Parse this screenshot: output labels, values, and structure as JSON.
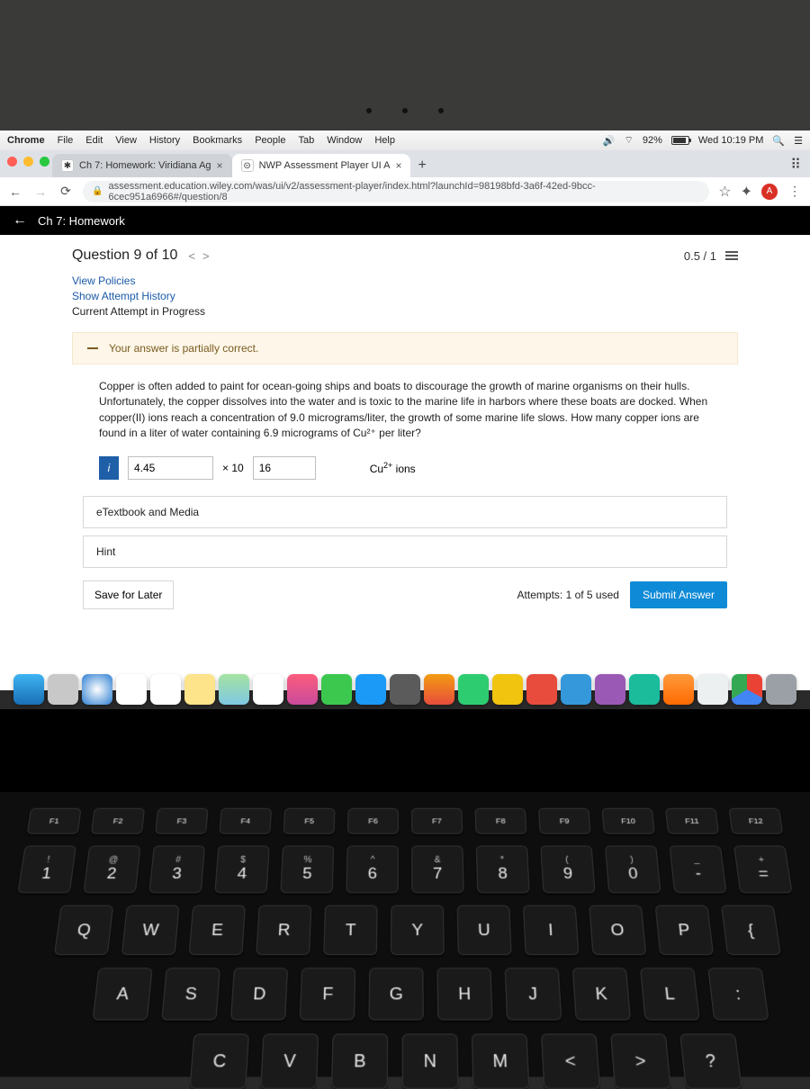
{
  "mac": {
    "app": "Chrome",
    "menus": [
      "File",
      "Edit",
      "View",
      "History",
      "Bookmarks",
      "People",
      "Tab",
      "Window",
      "Help"
    ],
    "battery_pct": "92%",
    "clock": "Wed 10:19 PM"
  },
  "browser": {
    "tabs": [
      {
        "title": "Ch 7: Homework: Viridiana Ag"
      },
      {
        "title": "NWP Assessment Player UI A"
      }
    ],
    "url": "assessment.education.wiley.com/was/ui/v2/assessment-player/index.html?launchId=98198bfd-3a6f-42ed-9bcc-6cec951a6966#/question/8"
  },
  "assessment": {
    "breadcrumb": "Ch 7: Homework",
    "question_label": "Question 9 of 10",
    "score": "0.5 / 1",
    "link_policies": "View Policies",
    "link_history": "Show Attempt History",
    "current_attempt": "Current Attempt in Progress",
    "banner": "Your answer is partially correct.",
    "prompt": "Copper is often added to paint for ocean-going ships and boats to discourage the growth of marine organisms on their hulls. Unfortunately, the copper dissolves into the water and is toxic to the marine life in harbors where these boats are docked. When copper(II) ions reach a concentration of 9.0 micrograms/liter, the growth of some marine life slows. How many copper ions are found in a liter of water containing 6.9 micrograms of Cu²⁺ per liter?",
    "info_label": "i",
    "value1": "4.45",
    "times_label": "× 10",
    "value2": "16",
    "unit_html": "Cu²⁺ ions",
    "panel_etext": "eTextbook and Media",
    "panel_hint": "Hint",
    "save_label": "Save for Later",
    "attempts": "Attempts: 1 of 5 used",
    "submit_label": "Submit Answer"
  },
  "keyboard": {
    "fn": [
      "F1",
      "F2",
      "F3",
      "F4",
      "F5",
      "F6",
      "F7",
      "F8",
      "F9",
      "F10",
      "F11",
      "F12"
    ],
    "num_top": [
      "!",
      "@",
      "#",
      "$",
      "%",
      "^",
      "&",
      "*",
      "(",
      ")",
      "_",
      "+"
    ],
    "num": [
      "1",
      "2",
      "3",
      "4",
      "5",
      "6",
      "7",
      "8",
      "9",
      "0",
      "-",
      "="
    ],
    "r1": [
      "Q",
      "W",
      "E",
      "R",
      "T",
      "Y",
      "U",
      "I",
      "O",
      "P",
      "{"
    ],
    "r2": [
      "A",
      "S",
      "D",
      "F",
      "G",
      "H",
      "J",
      "K",
      "L",
      ":"
    ],
    "r3": [
      "C",
      "V",
      "B",
      "N",
      "M",
      "<",
      ">",
      "?"
    ]
  }
}
